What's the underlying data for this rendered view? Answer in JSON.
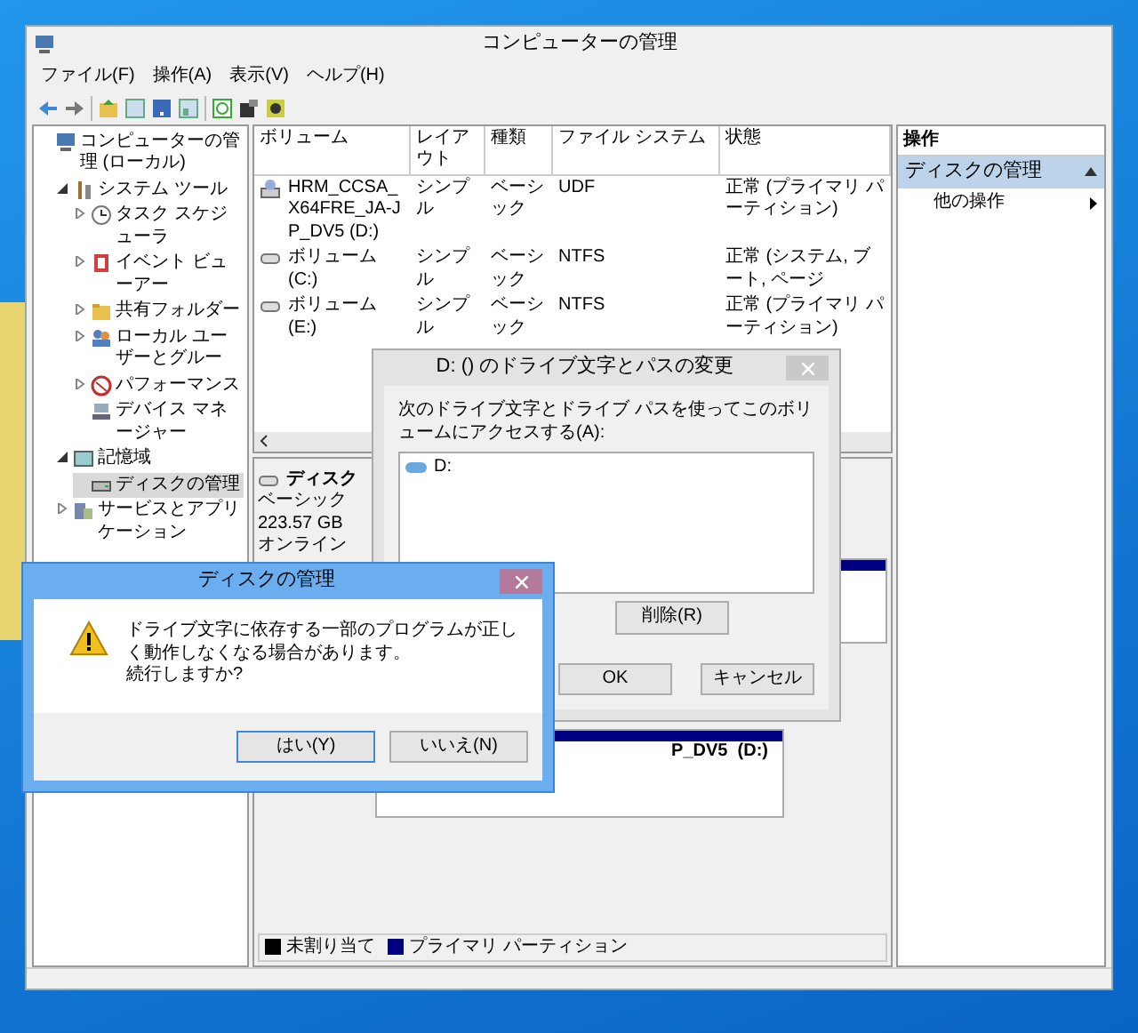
{
  "window": {
    "title": "コンピューターの管理"
  },
  "menu": [
    "ファイル(F)",
    "操作(A)",
    "表示(V)",
    "ヘルプ(H)"
  ],
  "tree": [
    {
      "label": "コンピューターの管理 (ローカル)",
      "kind": "computer",
      "selected": false,
      "children": [
        {
          "label": "システム ツール",
          "kind": "tools",
          "expanded": true,
          "selected": false,
          "children": [
            {
              "label": "タスク スケジューラ",
              "kind": "clock",
              "expanded": false,
              "selected": false
            },
            {
              "label": "イベント ビューアー",
              "kind": "events",
              "expanded": false,
              "selected": false
            },
            {
              "label": "共有フォルダー",
              "kind": "folder",
              "expanded": false,
              "selected": false
            },
            {
              "label": "ローカル ユーザーとグルー",
              "kind": "users",
              "expanded": false,
              "selected": false
            },
            {
              "label": "パフォーマンス",
              "kind": "gauge",
              "expanded": false,
              "selected": false
            },
            {
              "label": "デバイス マネージャー",
              "kind": "device",
              "selected": false
            }
          ]
        },
        {
          "label": "記憶域",
          "kind": "storage",
          "expanded": true,
          "selected": false,
          "children": [
            {
              "label": "ディスクの管理",
              "kind": "disk",
              "selected": true
            }
          ]
        },
        {
          "label": "サービスとアプリケーション",
          "kind": "services",
          "expanded": false,
          "selected": false
        }
      ]
    }
  ],
  "volumes": {
    "columns": [
      "ボリューム",
      "レイアウト",
      "種類",
      "ファイル システム",
      "状態"
    ],
    "rows": [
      {
        "kind": "optical",
        "cells": [
          "HRM_CCSA_X64FRE_JA-JP_DV5 (D:)",
          "シンプル",
          "ベーシック",
          "UDF",
          "正常 (プライマリ パーティション)"
        ]
      },
      {
        "kind": "drive",
        "cells": [
          "ボリューム (C:)",
          "シンプル",
          "ベーシック",
          "NTFS",
          "正常 (システム, ブート, ページ"
        ]
      },
      {
        "kind": "drive",
        "cells": [
          "ボリューム (E:)",
          "シンプル",
          "ベーシック",
          "NTFS",
          "正常 (プライマリ パーティション)"
        ]
      }
    ]
  },
  "disk": {
    "name": "ディスク",
    "type": "ベーシック",
    "size": "223.57 GB",
    "status": "オンライン"
  },
  "partition_label": "P_DV5  (D:)",
  "legend": [
    {
      "label": "未割り当て",
      "color": "#000000"
    },
    {
      "label": "プライマリ パーティション",
      "color": "#000080"
    }
  ],
  "actions": {
    "header": "操作",
    "section": "ディスクの管理",
    "expanded": true,
    "items": [
      "他の操作"
    ]
  },
  "path_dialog": {
    "title": "D: () のドライブ文字とパスの変更",
    "prompt": "次のドライブ文字とドライブ パスを使ってこのボリュームにアクセスする(A):",
    "entries": [
      "D:"
    ],
    "remove_button": "削除(R)",
    "buttons": [
      "OK",
      "キャンセル"
    ]
  },
  "confirm_dialog": {
    "title": "ディスクの管理",
    "message": [
      "ドライブ文字に依存する一部のプログラムが正しく動作しなくなる場合があります。",
      "続行しますか?"
    ],
    "buttons": [
      {
        "label": "はい(Y)",
        "focused": true
      },
      {
        "label": "いいえ(N)",
        "focused": false
      }
    ]
  }
}
